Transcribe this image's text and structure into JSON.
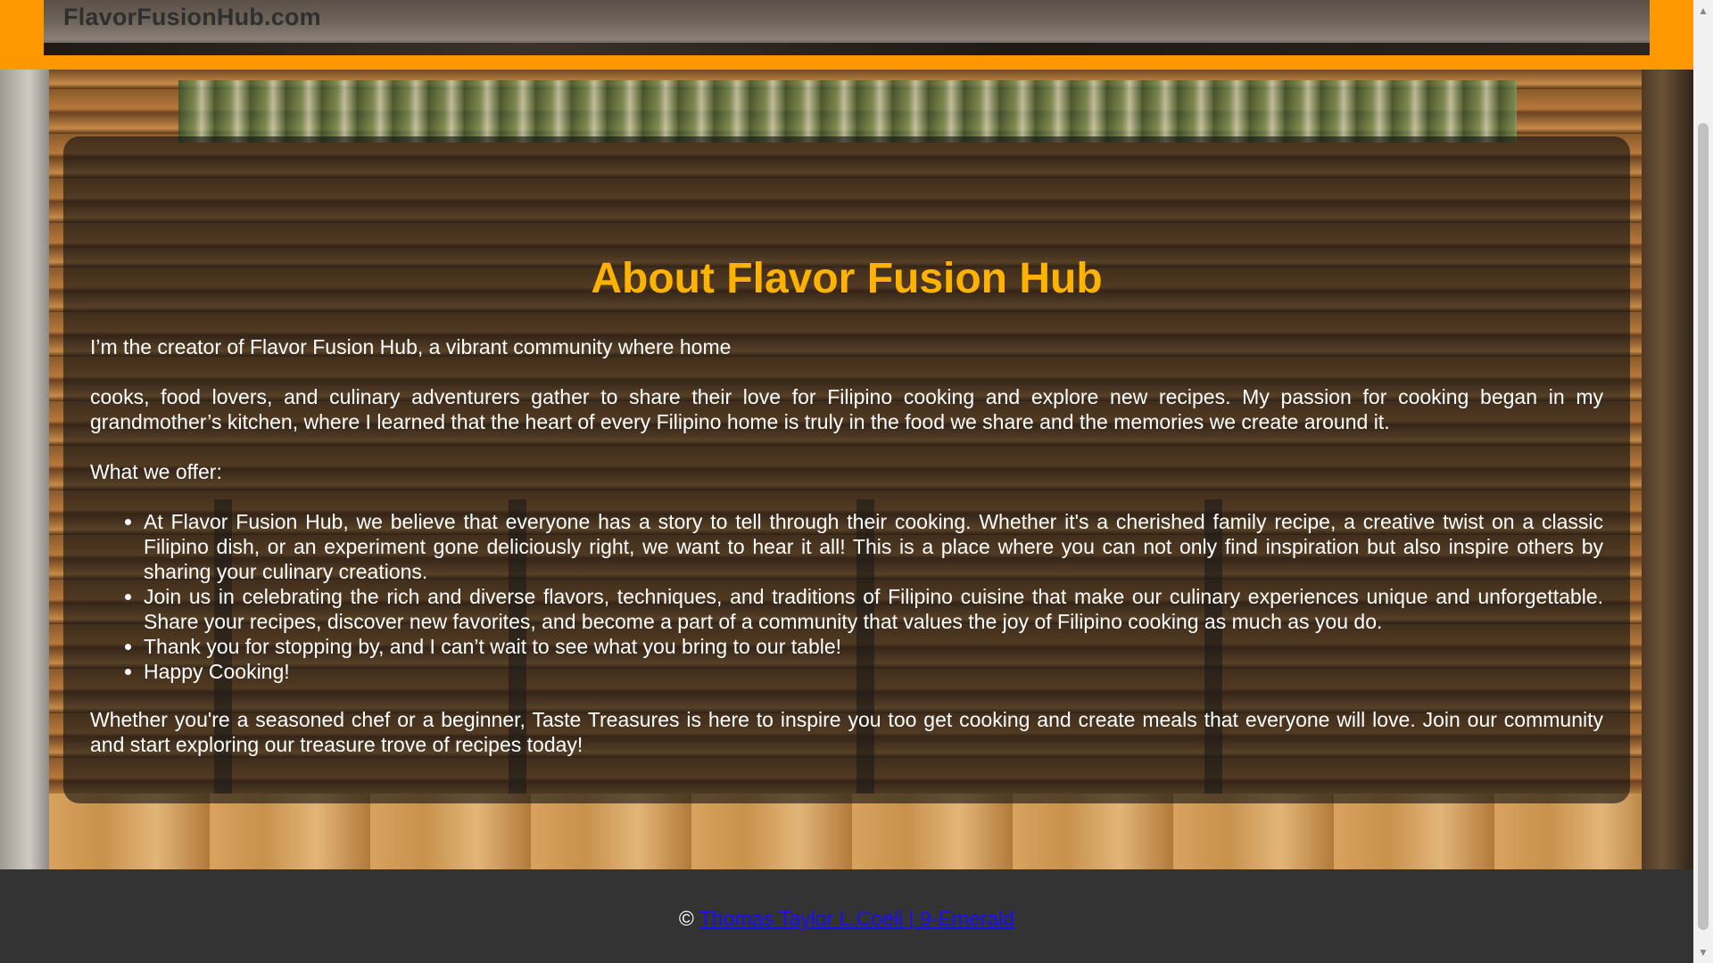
{
  "header": {
    "logo": "FlavorFusionHub.com"
  },
  "about": {
    "title": "About Flavor Fusion Hub",
    "intro_line": "I’m the creator of Flavor Fusion Hub, a vibrant community where home",
    "intro_paragraph": "cooks, food lovers, and culinary adventurers gather to share their love for Filipino cooking and explore new recipes. My passion for cooking began in my grandmother’s kitchen, where I learned that the heart of every Filipino home is truly in the food we share and the memories we create around it.",
    "offer_heading": "What we offer:",
    "offers": [
      "At Flavor Fusion Hub, we believe that everyone has a story to tell through their cooking. Whether it's a cherished family recipe, a creative twist on a classic Filipino dish, or an experiment gone deliciously right, we want to hear it all! This is a place where you can not only find inspiration but also inspire others by sharing your culinary creations.",
      "Join us in celebrating the rich and diverse flavors, techniques, and traditions of Filipino cuisine that make our culinary experiences unique and unforgettable. Share your recipes, discover new favorites, and become a part of a community that values the joy of Filipino cooking as much as you do.",
      "Thank you for stopping by, and I can’t wait to see what you bring to our table!",
      "Happy Cooking!"
    ],
    "closing_paragraph": "Whether you're a seasoned chef or a beginner, Taste Treasures is here to inspire you too get cooking and create meals that everyone will love. Join our community and start exploring our treasure trove of recipes today!"
  },
  "footer": {
    "copyright_symbol": "©",
    "author_link": "Thomas Taylor L.Coeli | 9-Emerald"
  },
  "scrollbar": {
    "up_icon": "▲",
    "down_icon": "▼"
  },
  "colors": {
    "header_accent": "#ff9800",
    "title": "#ffb300",
    "footer_bg": "#333333",
    "link": "#1a0dff"
  }
}
